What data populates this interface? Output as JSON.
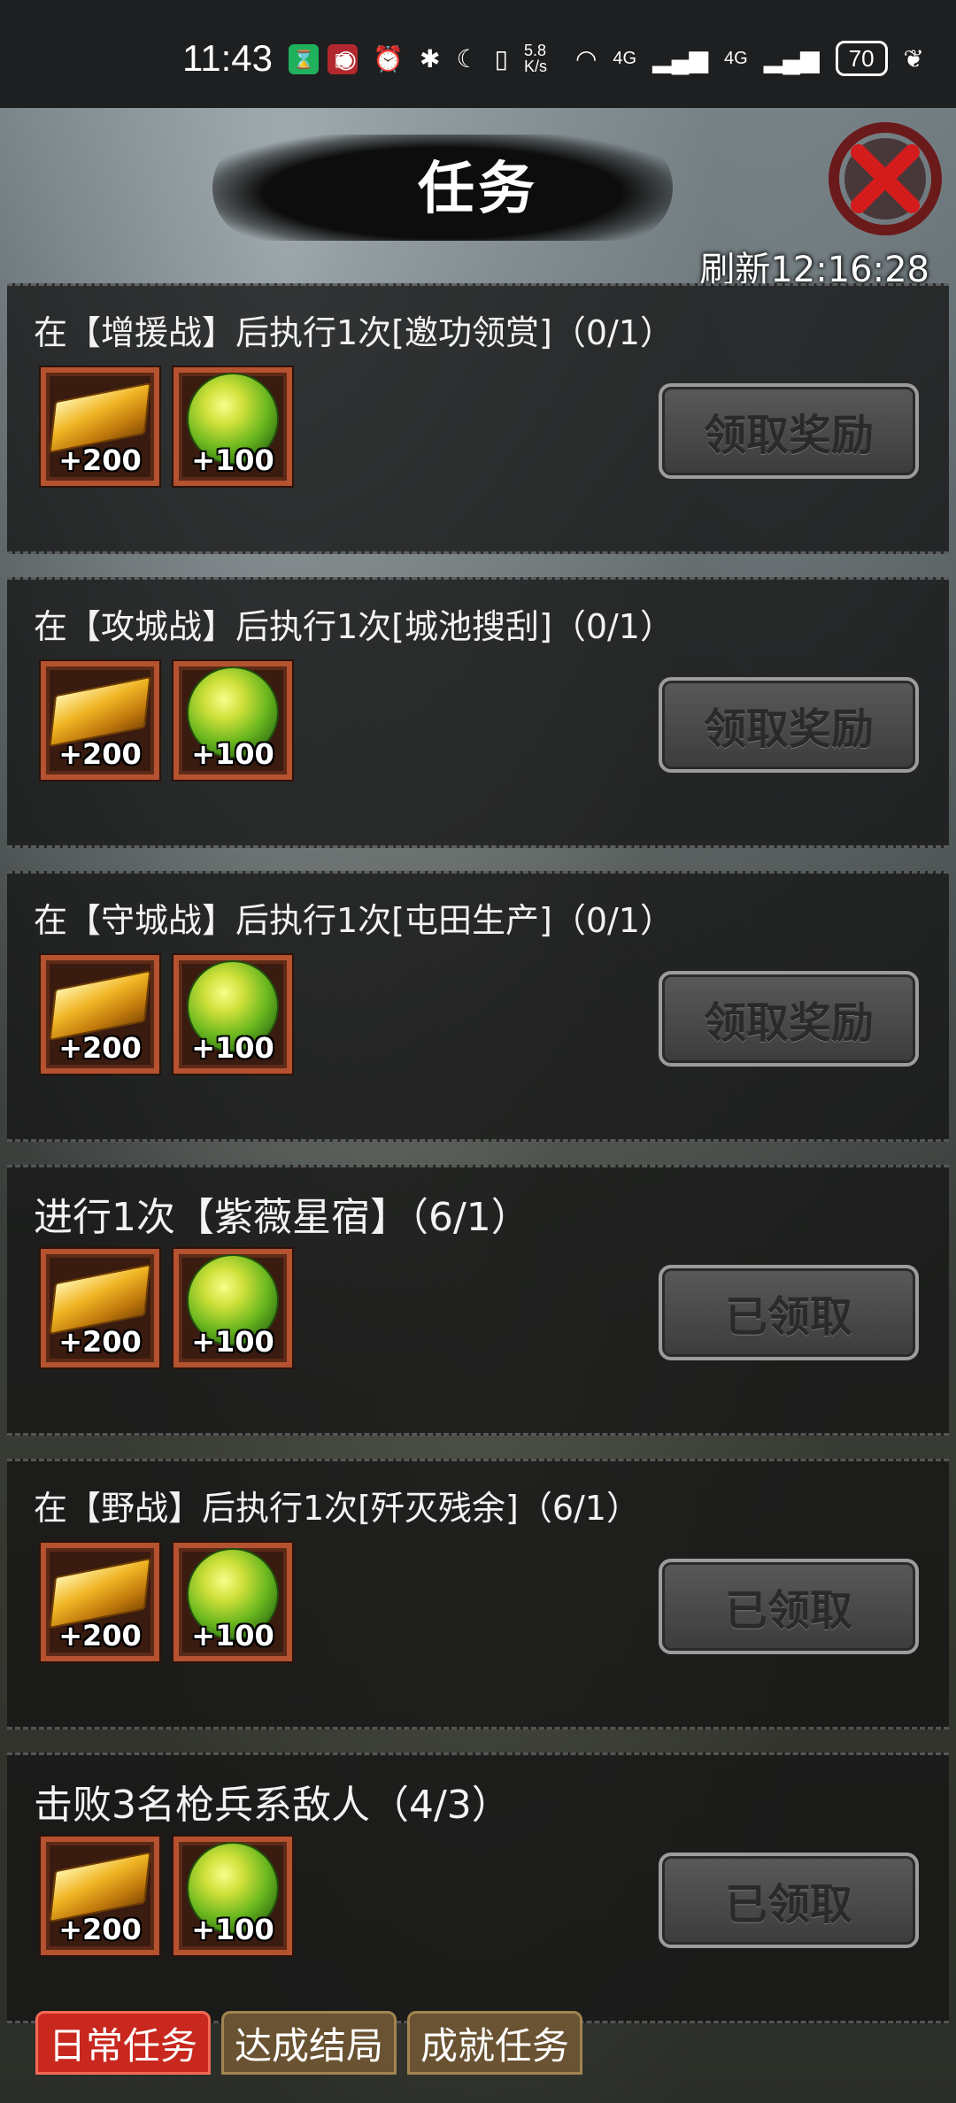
{
  "status_bar": {
    "time": "11:43",
    "network_speed": "5.8 K/s",
    "signal1": "4G",
    "signal2": "4G",
    "battery": "70"
  },
  "header": {
    "title": "任务",
    "refresh_label": "刷新12:16:28"
  },
  "tasks": [
    {
      "desc": "在【增援战】后执行1次[邀功领赏]（0/1）",
      "gold": "+200",
      "orb": "+100",
      "button": "领取奖励",
      "claimed": false
    },
    {
      "desc": "在【攻城战】后执行1次[城池搜刮]（0/1）",
      "gold": "+200",
      "orb": "+100",
      "button": "领取奖励",
      "claimed": false
    },
    {
      "desc": "在【守城战】后执行1次[屯田生产]（0/1）",
      "gold": "+200",
      "orb": "+100",
      "button": "领取奖励",
      "claimed": false
    },
    {
      "desc": "进行1次【紫薇星宿】（6/1）",
      "gold": "+200",
      "orb": "+100",
      "button": "已领取",
      "claimed": true
    },
    {
      "desc": "在【野战】后执行1次[歼灭残余]（6/1）",
      "gold": "+200",
      "orb": "+100",
      "button": "已领取",
      "claimed": true
    },
    {
      "desc": "击败3名枪兵系敌人（4/3）",
      "gold": "+200",
      "orb": "+100",
      "button": "已领取",
      "claimed": true
    }
  ],
  "tabs": [
    {
      "label": "日常任务",
      "active": true
    },
    {
      "label": "达成结局",
      "active": false
    },
    {
      "label": "成就任务",
      "active": false
    }
  ]
}
